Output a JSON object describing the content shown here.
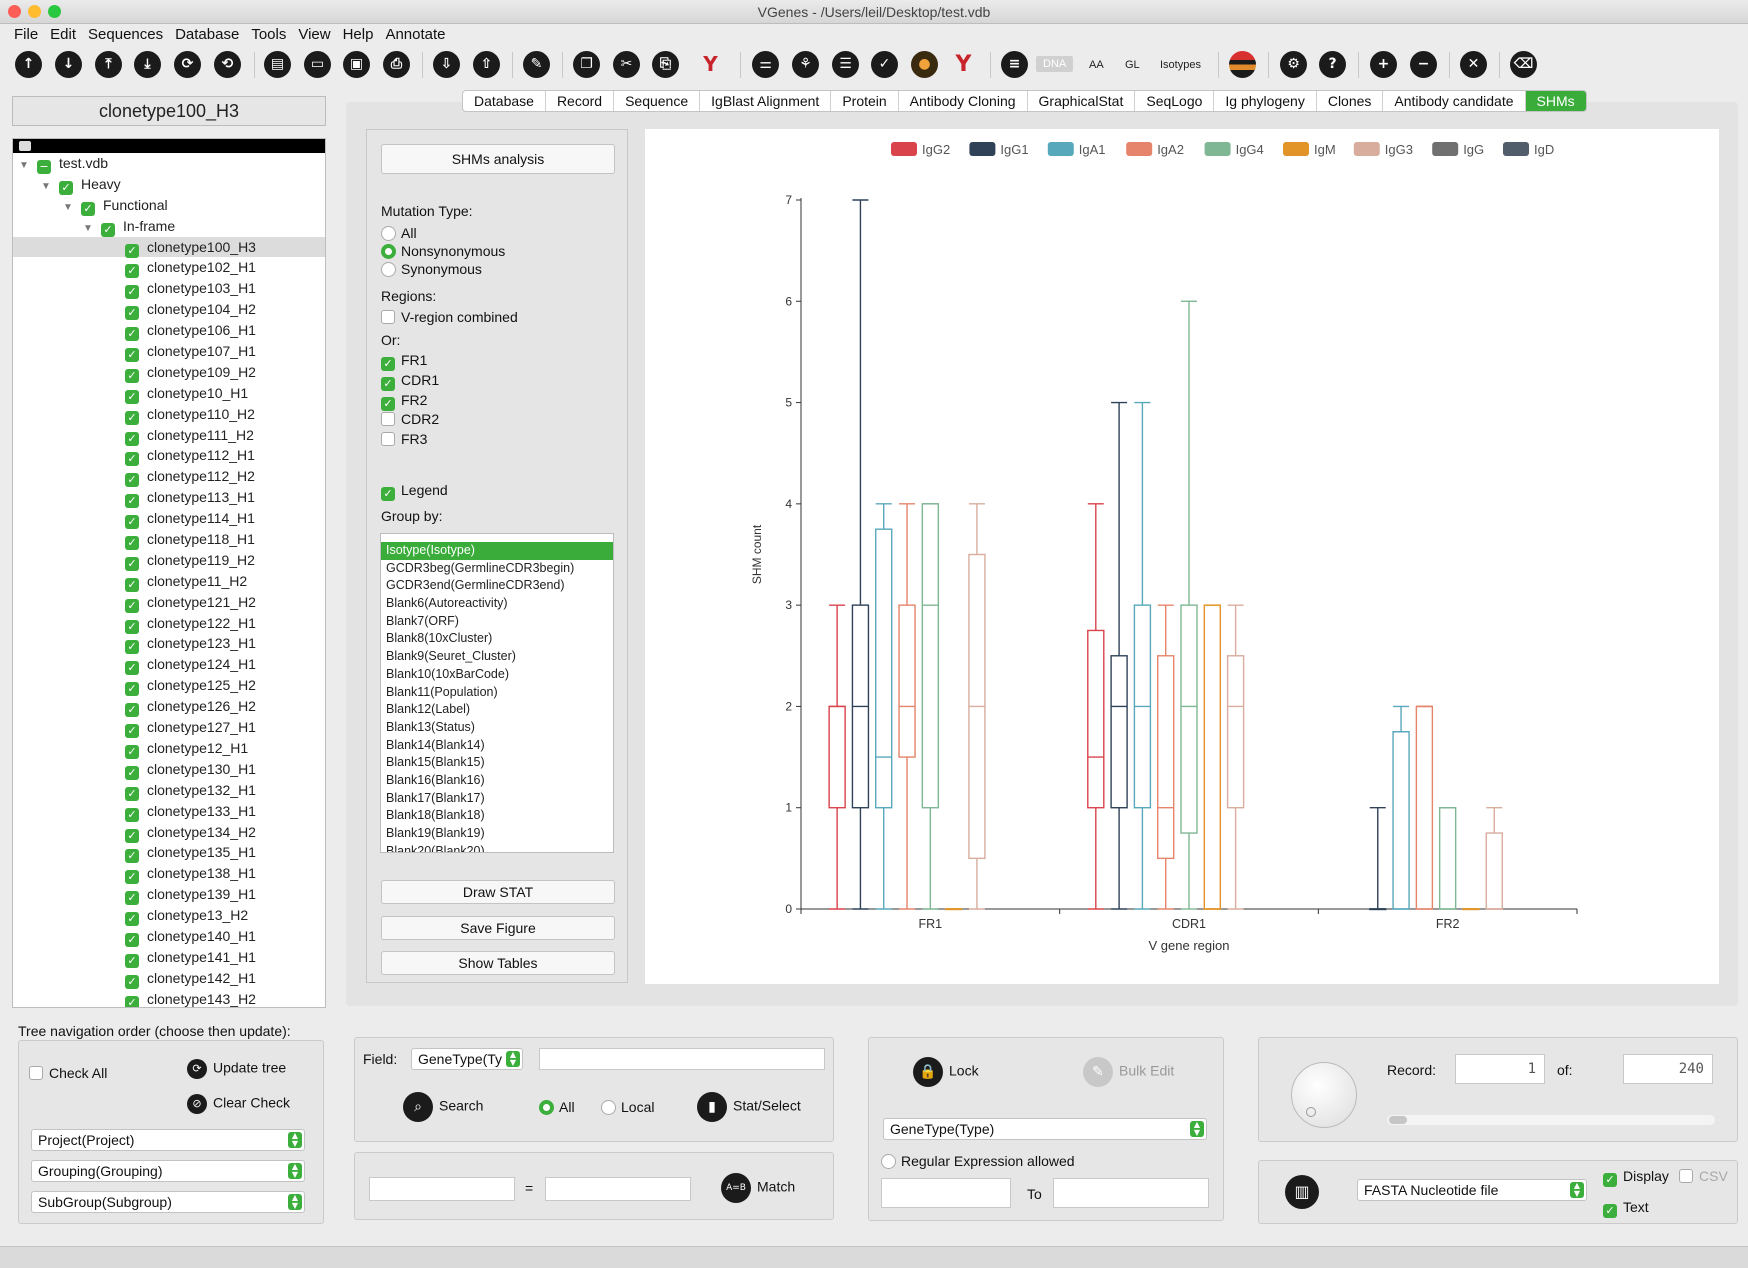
{
  "window": {
    "title": "VGenes - /Users/leil/Desktop/test.vdb"
  },
  "menu": [
    "File",
    "Edit",
    "Sequences",
    "Database",
    "Tools",
    "View",
    "Help",
    "Annotate"
  ],
  "toolbar": {
    "dna": "DNA",
    "aa": "AA",
    "gl": "GL",
    "isotypes": "Isotypes"
  },
  "clone_title": "clonetype100_H3",
  "tree": {
    "root": "test.vdb",
    "level1": "Heavy",
    "level2": "Functional",
    "level3": "In-frame",
    "items": [
      "clonetype100_H3",
      "clonetype102_H1",
      "clonetype103_H1",
      "clonetype104_H2",
      "clonetype106_H1",
      "clonetype107_H1",
      "clonetype109_H2",
      "clonetype10_H1",
      "clonetype110_H2",
      "clonetype111_H2",
      "clonetype112_H1",
      "clonetype112_H2",
      "clonetype113_H1",
      "clonetype114_H1",
      "clonetype118_H1",
      "clonetype119_H2",
      "clonetype11_H2",
      "clonetype121_H2",
      "clonetype122_H1",
      "clonetype123_H1",
      "clonetype124_H1",
      "clonetype125_H2",
      "clonetype126_H2",
      "clonetype127_H1",
      "clonetype12_H1",
      "clonetype130_H1",
      "clonetype132_H1",
      "clonetype133_H1",
      "clonetype134_H2",
      "clonetype135_H1",
      "clonetype138_H1",
      "clonetype139_H1",
      "clonetype13_H2",
      "clonetype140_H1",
      "clonetype141_H1",
      "clonetype142_H1",
      "clonetype143_H2"
    ]
  },
  "tabs": [
    "Database",
    "Record",
    "Sequence",
    "IgBlast Alignment",
    "Protein",
    "Antibody Cloning",
    "GraphicalStat",
    "SeqLogo",
    "Ig phylogeny",
    "Clones",
    "Antibody candidate",
    "SHMs"
  ],
  "controls": {
    "shms_button": "SHMs analysis",
    "mutation_type_label": "Mutation Type:",
    "mutation_options": [
      "All",
      "Nonsynonymous",
      "Synonymous"
    ],
    "regions_label": "Regions:",
    "v_region_combined": "V-region combined",
    "or_label": "Or:",
    "regions": [
      {
        "label": "FR1",
        "checked": true
      },
      {
        "label": "CDR1",
        "checked": true
      },
      {
        "label": "FR2",
        "checked": true
      },
      {
        "label": "CDR2",
        "checked": false
      },
      {
        "label": "FR3",
        "checked": false
      }
    ],
    "legend_label": "Legend",
    "group_by_label": "Group by:",
    "group_options": [
      "Isotype(Isotype)",
      "GCDR3beg(GermlineCDR3begin)",
      "GCDR3end(GermlineCDR3end)",
      "Blank6(Autoreactivity)",
      "Blank7(ORF)",
      "Blank8(10xCluster)",
      "Blank9(Seuret_Cluster)",
      "Blank10(10xBarCode)",
      "Blank11(Population)",
      "Blank12(Label)",
      "Blank13(Status)",
      "Blank14(Blank14)",
      "Blank15(Blank15)",
      "Blank16(Blank16)",
      "Blank17(Blank17)",
      "Blank18(Blank18)",
      "Blank19(Blank19)",
      "Blank20(Blank20)"
    ],
    "draw_stat": "Draw STAT",
    "save_figure": "Save Figure",
    "show_tables": "Show Tables"
  },
  "chart_data": {
    "type": "boxplot",
    "xlabel": "V gene region",
    "ylabel": "SHM count",
    "ylim": [
      0,
      7
    ],
    "yticks": [
      0,
      1,
      2,
      3,
      4,
      5,
      6,
      7
    ],
    "categories": [
      "FR1",
      "CDR1",
      "FR2"
    ],
    "legend_position": "top",
    "series": [
      {
        "name": "IgG2",
        "color": "#d9434b",
        "boxes": [
          [
            0,
            1,
            2,
            2,
            3
          ],
          [
            0,
            1,
            1.5,
            2.75,
            4
          ],
          null
        ]
      },
      {
        "name": "IgG1",
        "color": "#2f4258",
        "boxes": [
          [
            0,
            1,
            2,
            3,
            7
          ],
          [
            0,
            1,
            2,
            2.5,
            5
          ],
          [
            0,
            0,
            0,
            0,
            1
          ]
        ]
      },
      {
        "name": "IgA1",
        "color": "#58a8bb",
        "boxes": [
          [
            0,
            1,
            1.5,
            3.75,
            4
          ],
          [
            0,
            1,
            2,
            3,
            5
          ],
          [
            0,
            0,
            1.75,
            1.75,
            2
          ]
        ]
      },
      {
        "name": "IgA2",
        "color": "#e5846b",
        "boxes": [
          [
            0,
            1.5,
            2,
            3,
            4
          ],
          [
            0,
            0.5,
            1,
            2.5,
            3
          ],
          [
            0,
            0,
            2,
            2,
            2
          ]
        ]
      },
      {
        "name": "IgG4",
        "color": "#7fb693",
        "boxes": [
          [
            0,
            1,
            3,
            4,
            4
          ],
          [
            0,
            0.75,
            2,
            3,
            6
          ],
          [
            0,
            0,
            1,
            1,
            1
          ]
        ]
      },
      {
        "name": "IgM",
        "color": "#e39429",
        "boxes": [
          [
            0,
            0,
            0,
            0,
            0
          ],
          [
            0,
            0,
            0,
            3,
            3
          ],
          [
            0,
            0,
            0,
            0,
            0
          ]
        ]
      },
      {
        "name": "IgG3",
        "color": "#d8ad9e",
        "boxes": [
          [
            0,
            0.5,
            2,
            3.5,
            4
          ],
          [
            0,
            1,
            2,
            2.5,
            3
          ],
          [
            0,
            0,
            0,
            0.75,
            1
          ]
        ]
      },
      {
        "name": "IgG",
        "color": "#707070",
        "boxes": [
          null,
          null,
          null
        ]
      },
      {
        "name": "IgD",
        "color": "#525d6b",
        "boxes": [
          null,
          null,
          null
        ]
      }
    ]
  },
  "bottom": {
    "tree_nav_label": "Tree navigation order (choose then update):",
    "check_all": "Check All",
    "update_tree": "Update tree",
    "clear_check": "Clear Check",
    "sort1": "Project(Project)",
    "sort2": "Grouping(Grouping)",
    "sort3": "SubGroup(Subgroup)",
    "field_label": "Field:",
    "field_value": "GeneType(Ty",
    "search": "Search",
    "all": "All",
    "local": "Local",
    "stat_select": "Stat/Select",
    "equals": "=",
    "match": "Match",
    "lock": "Lock",
    "bulk_edit": "Bulk Edit",
    "genetype": "GeneType(Type)",
    "regex": "Regular Expression allowed",
    "to": "To",
    "record_label": "Record:",
    "record_value": "1",
    "of_label": "of:",
    "of_value": "240",
    "export_format": "FASTA Nucleotide file",
    "display": "Display",
    "csv": "CSV",
    "text": "Text"
  },
  "colors": {
    "accent": "#3aac3a"
  }
}
